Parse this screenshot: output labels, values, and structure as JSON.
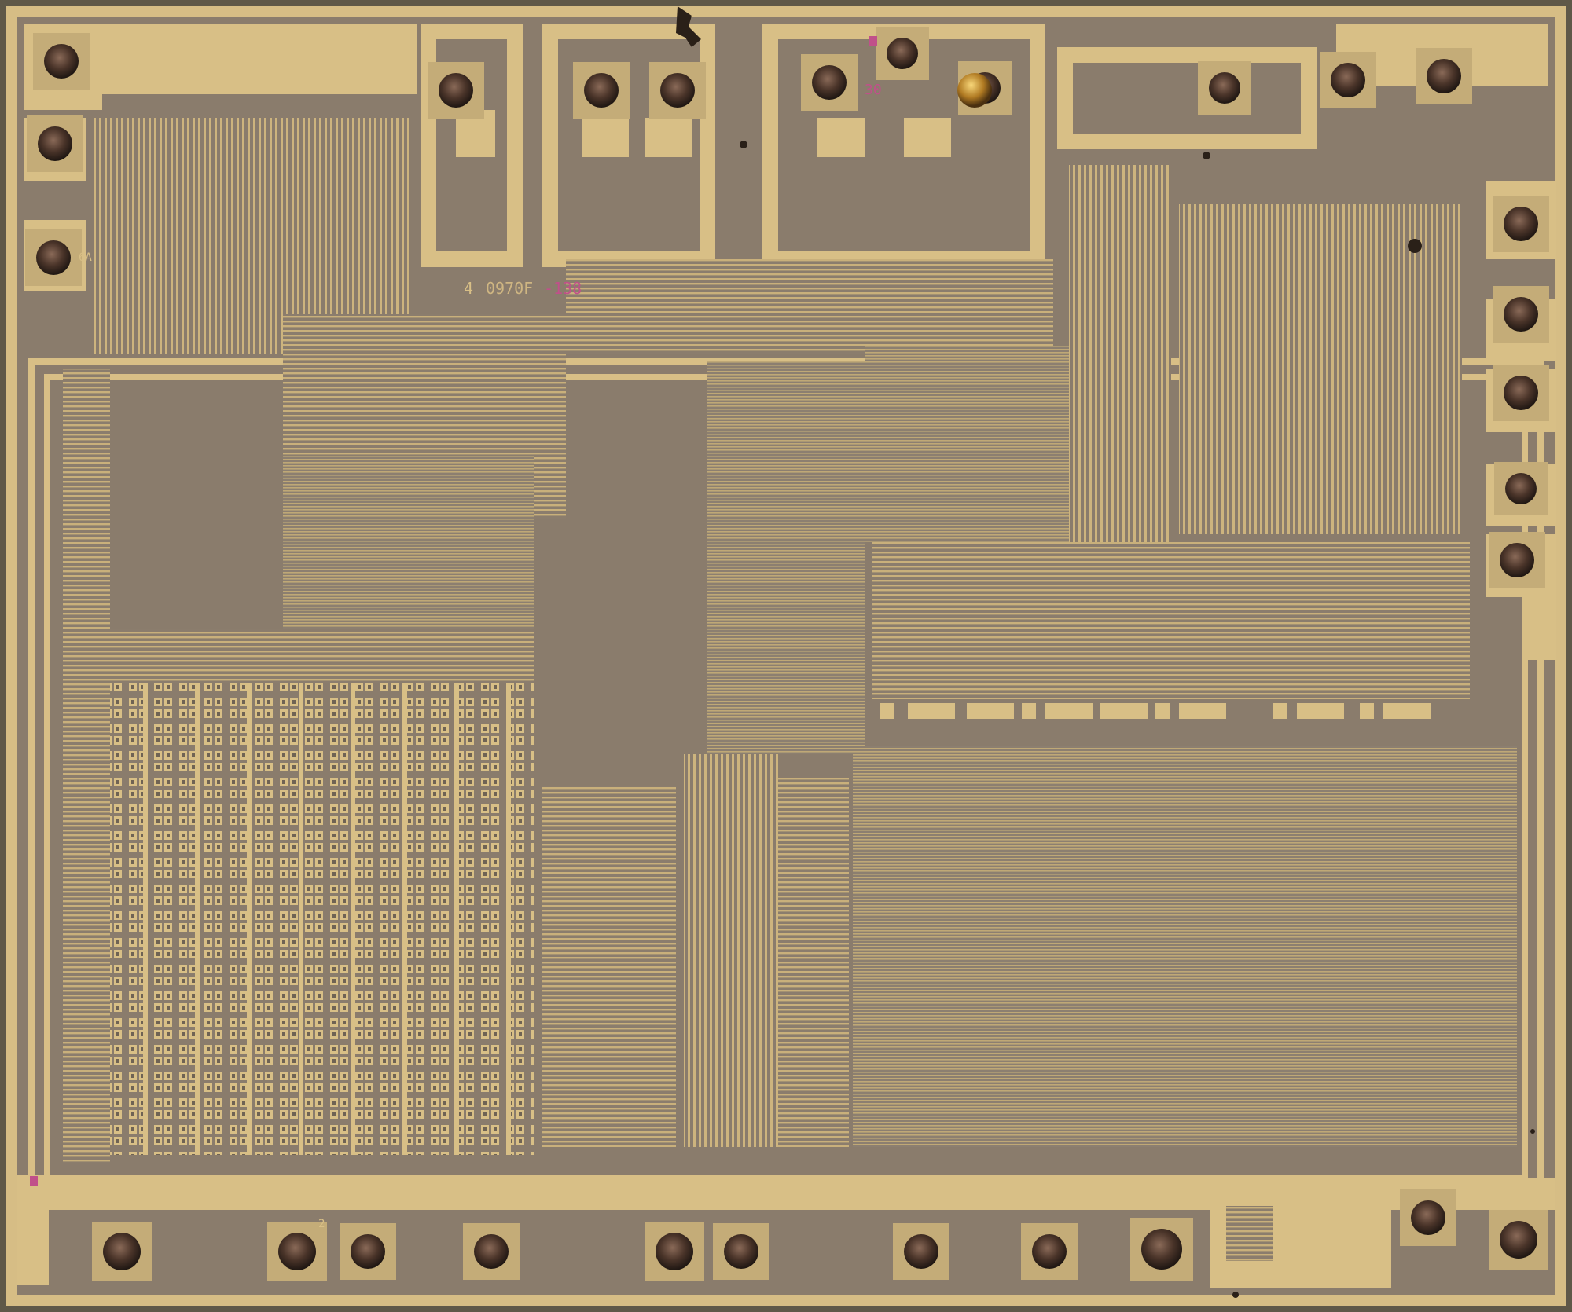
{
  "image": {
    "subject": "integrated-circuit-die-photo",
    "colors": {
      "substrate": "#8a7c6c",
      "metal": "#d8bf86",
      "metal_light": "#e6d09a",
      "border": "#5a5346",
      "bond_ball": "#5a4236",
      "bond_ball_dark": "#2a1f1a",
      "label_magenta": "#c0508a"
    }
  },
  "markings": {
    "die_id_prefix": "4",
    "die_id_mid": "0970F",
    "die_id_suffix": "-138",
    "pad_label_top": "30",
    "pad_label_left": "6A",
    "pad_label_bottom": "2"
  }
}
